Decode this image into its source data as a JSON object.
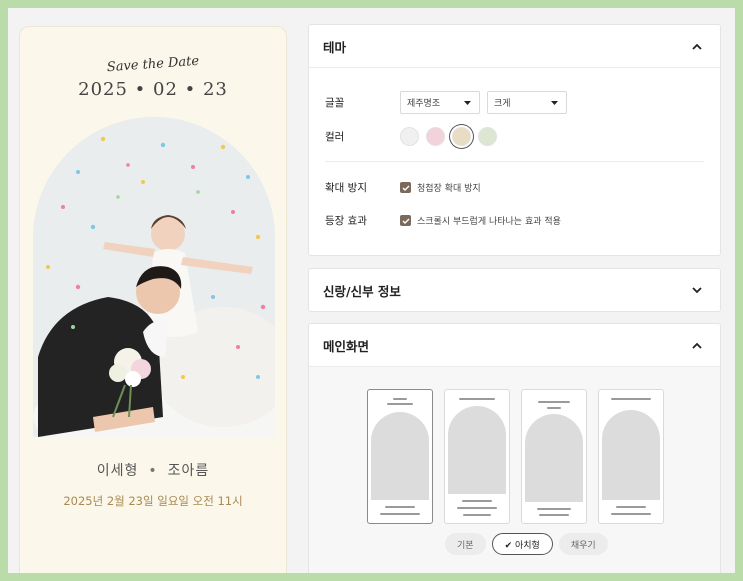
{
  "preview": {
    "save_the_date": "Save the Date",
    "date": "2025 • 02 • 23",
    "groom": "이세형",
    "separator": "•",
    "bride": "조아름",
    "wedding_datetime": "2025년 2월 23일 일요일 오전 11시"
  },
  "theme": {
    "title": "테마",
    "font_label": "글꼴",
    "font_value": "제주명조",
    "size_value": "크게",
    "color_label": "컬러",
    "colors": [
      "#f0f0f0",
      "#f3d2dc",
      "#e8dcc2",
      "#dde6d2"
    ],
    "selected_color_index": 2,
    "zoom_label": "확대 방지",
    "zoom_check_text": "청첩장 확대 방지",
    "zoom_checked": true,
    "effect_label": "등장 효과",
    "effect_check_text": "스크롤시 부드럽게 나타나는 효과 적용",
    "effect_checked": true,
    "check_color": "#7b6a5b"
  },
  "groom_bride": {
    "title": "신랑/신부 정보"
  },
  "main_screen": {
    "title": "메인화면",
    "layout_count": 4,
    "options": [
      "기본",
      "✔ 아치형",
      "채우기"
    ],
    "selected_option_index": 1
  }
}
